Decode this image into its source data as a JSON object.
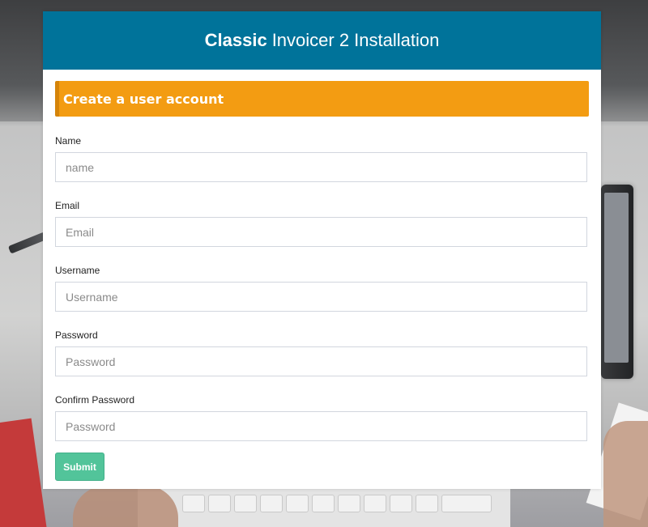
{
  "header": {
    "brand": "Classic",
    "title": "Invoicer 2 Installation"
  },
  "section": {
    "title": "Create a user account"
  },
  "form": {
    "fields": [
      {
        "label": "Name",
        "placeholder": "name",
        "type": "text"
      },
      {
        "label": "Email",
        "placeholder": "Email",
        "type": "email"
      },
      {
        "label": "Username",
        "placeholder": "Username",
        "type": "text"
      },
      {
        "label": "Password",
        "placeholder": "Password",
        "type": "password"
      },
      {
        "label": "Confirm Password",
        "placeholder": "Password",
        "type": "password"
      }
    ],
    "submit_label": "Submit"
  },
  "colors": {
    "header_bg": "#00739a",
    "banner_bg": "#f39c12",
    "submit_bg": "#52c49a"
  }
}
